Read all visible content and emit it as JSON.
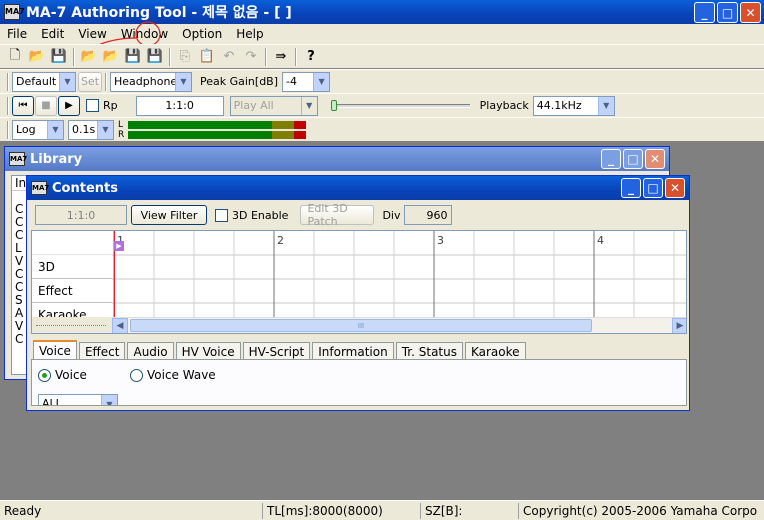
{
  "app": {
    "title": "MA-7 Authoring Tool - 제목 없음 - [ ]",
    "icon_label": "MA7"
  },
  "window_controls": {
    "minimize": "_",
    "maximize": "□",
    "close": "✕"
  },
  "menu": [
    "File",
    "Edit",
    "View",
    "Window",
    "Option",
    "Help"
  ],
  "toolbar1": {
    "icons": [
      "new-file-icon",
      "open-folder-icon",
      "save-icon",
      "open-project-icon",
      "open-folder2-icon",
      "save-disabled-icon",
      "save-red-icon",
      "copy-icon",
      "paste-icon",
      "undo-icon",
      "redo-icon",
      "export-icon",
      "help-icon"
    ]
  },
  "toolbar2": {
    "preset_value": "Default",
    "set_label": "Set",
    "output_value": "Headphone",
    "peak_gain_label": "Peak Gain[dB]",
    "peak_gain_value": "-4"
  },
  "toolbar3": {
    "rp_label": "Rp",
    "position_value": "1:1:0",
    "play_mode_value": "Play All",
    "playback_label": "Playback",
    "playback_rate": "44.1kHz"
  },
  "toolbar4": {
    "scale_value": "Log",
    "time_value": "0.1s",
    "channel_l": "L",
    "channel_r": "R"
  },
  "library": {
    "title": "Library",
    "tab_fragment": "In",
    "list_letters": [
      "C",
      "C",
      "C",
      "L",
      "V",
      "C",
      "C",
      "S",
      "A",
      "V",
      "C"
    ]
  },
  "contents": {
    "title": "Contents",
    "position_value": "1:1:0",
    "view_filter_label": "View Filter",
    "enable_3d_label": "3D Enable",
    "edit_3d_patch_label": "Edit 3D Patch",
    "div_label": "Div",
    "div_value": "960",
    "measures": [
      "1",
      "2",
      "3",
      "4"
    ],
    "tracks": [
      "3D",
      "Effect",
      "Karaoke"
    ],
    "tabs": [
      "Voice",
      "Effect",
      "Audio",
      "HV Voice",
      "HV-Script",
      "Information",
      "Tr. Status",
      "Karaoke"
    ],
    "active_tab": "Voice",
    "radio_voice": "Voice",
    "radio_voice_wave": "Voice Wave",
    "filter_value": "ALL",
    "scroll_grip": "III"
  },
  "status": {
    "ready": "Ready",
    "tl": "TL[ms]:8000(8000)",
    "sz": "SZ[B]:",
    "copyright": "Copyright(c) 2005-2006 Yamaha Corpo"
  },
  "colors": {
    "title_blue": "#0a5fd8",
    "level_green": "#008000",
    "level_olive": "#808000",
    "level_red": "#c00000",
    "annotation_red": "#e02020"
  }
}
